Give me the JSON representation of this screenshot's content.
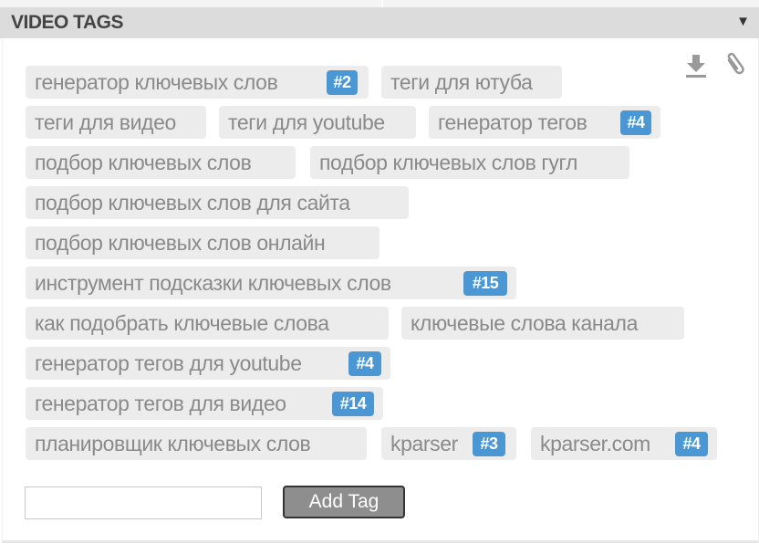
{
  "header": {
    "title": "VIDEO TAGS",
    "toggle_icon": "triangle-down-icon"
  },
  "toolbar": {
    "download_icon": "download-icon",
    "attach_icon": "paperclip-icon"
  },
  "tags": [
    {
      "label": "генератор ключевых слов",
      "badge": "#2"
    },
    {
      "label": "теги для ютуба"
    },
    {
      "label": "теги для видео"
    },
    {
      "label": "теги для youtube"
    },
    {
      "label": "генератор тегов",
      "badge": "#4"
    },
    {
      "label": "подбор ключевых слов"
    },
    {
      "label": "подбор ключевых слов гугл"
    },
    {
      "label": "подбор ключевых слов для сайта"
    },
    {
      "label": "подбор ключевых слов онлайн"
    },
    {
      "label": "инструмент подсказки ключевых слов",
      "badge": "#15"
    },
    {
      "label": "как подобрать ключевые слова"
    },
    {
      "label": "ключевые слова канала"
    },
    {
      "label": "генератор тегов для youtube",
      "badge": "#4"
    },
    {
      "label": "генератор тегов для видео",
      "badge": "#14"
    },
    {
      "label": "планировщик ключевых слов"
    },
    {
      "label": "kparser",
      "badge": "#3"
    },
    {
      "label": "kparser.com",
      "badge": "#4"
    }
  ],
  "form": {
    "input_value": "",
    "add_label": "Add Tag"
  },
  "colors": {
    "badge": "#4a97d4",
    "tag_bg": "#ececec",
    "header_bg": "#dcdcdc"
  }
}
